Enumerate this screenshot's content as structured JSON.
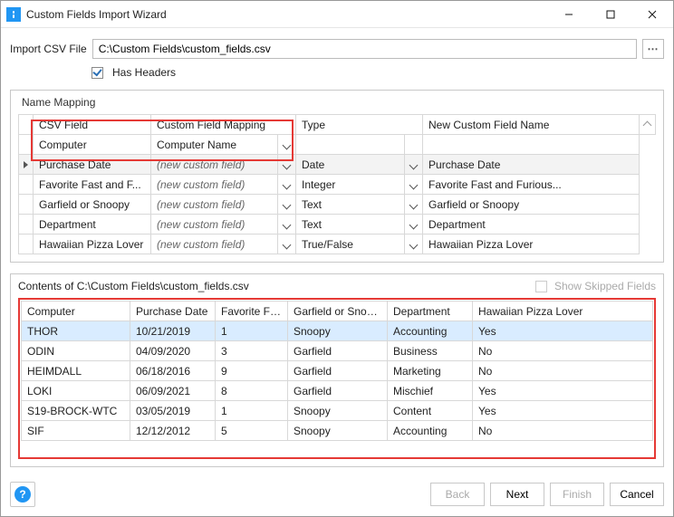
{
  "window": {
    "title": "Custom Fields Import Wizard"
  },
  "import": {
    "label": "Import CSV File",
    "path": "C:\\Custom Fields\\custom_fields.csv",
    "browse": "⋯",
    "has_headers_label": "Has Headers",
    "has_headers_checked": true
  },
  "mapping": {
    "panel_title": "Name Mapping",
    "headers": {
      "csv": "CSV Field",
      "map": "Custom Field Mapping",
      "type": "Type",
      "newname": "New Custom Field Name"
    },
    "new_custom_field_label": "(new custom field)",
    "rows": [
      {
        "active": false,
        "csv": "Computer",
        "map": "Computer Name",
        "is_new": false,
        "type": "",
        "newname": "",
        "show_dd1": true,
        "show_dd2": false
      },
      {
        "active": true,
        "csv": "Purchase Date",
        "map": "(new custom field)",
        "is_new": true,
        "type": "Date",
        "newname": "Purchase Date",
        "show_dd1": true,
        "show_dd2": true
      },
      {
        "active": false,
        "csv": "Favorite Fast and F...",
        "map": "(new custom field)",
        "is_new": true,
        "type": "Integer",
        "newname": "Favorite Fast and Furious...",
        "show_dd1": true,
        "show_dd2": true
      },
      {
        "active": false,
        "csv": "Garfield or Snoopy",
        "map": "(new custom field)",
        "is_new": true,
        "type": "Text",
        "newname": "Garfield or Snoopy",
        "show_dd1": true,
        "show_dd2": true
      },
      {
        "active": false,
        "csv": "Department",
        "map": "(new custom field)",
        "is_new": true,
        "type": "Text",
        "newname": "Department",
        "show_dd1": true,
        "show_dd2": true
      },
      {
        "active": false,
        "csv": "Hawaiian Pizza Lover",
        "map": "(new custom field)",
        "is_new": true,
        "type": "True/False",
        "newname": "Hawaiian Pizza Lover",
        "show_dd1": true,
        "show_dd2": true
      }
    ]
  },
  "preview": {
    "label_prefix": "Contents of ",
    "path": "C:\\Custom Fields\\custom_fields.csv",
    "skipped_label": "Show Skipped Fields",
    "headers": [
      "Computer",
      "Purchase Date",
      "Favorite Fas...",
      "Garfield or Snoopy",
      "Department",
      "Hawaiian Pizza Lover"
    ],
    "rows": [
      {
        "selected": true,
        "cells": [
          "THOR",
          "10/21/2019",
          "1",
          "Snoopy",
          "Accounting",
          "Yes"
        ]
      },
      {
        "selected": false,
        "cells": [
          "ODIN",
          "04/09/2020",
          "3",
          "Garfield",
          "Business",
          "No"
        ]
      },
      {
        "selected": false,
        "cells": [
          "HEIMDALL",
          "06/18/2016",
          "9",
          "Garfield",
          "Marketing",
          "No"
        ]
      },
      {
        "selected": false,
        "cells": [
          "LOKI",
          "06/09/2021",
          "8",
          "Garfield",
          "Mischief",
          "Yes"
        ]
      },
      {
        "selected": false,
        "cells": [
          "S19-BROCK-WTC",
          "03/05/2019",
          "1",
          "Snoopy",
          "Content",
          "Yes"
        ]
      },
      {
        "selected": false,
        "cells": [
          "SIF",
          "12/12/2012",
          "5",
          "Snoopy",
          "Accounting",
          "No"
        ]
      }
    ]
  },
  "footer": {
    "back": "Back",
    "next": "Next",
    "finish": "Finish",
    "cancel": "Cancel"
  }
}
